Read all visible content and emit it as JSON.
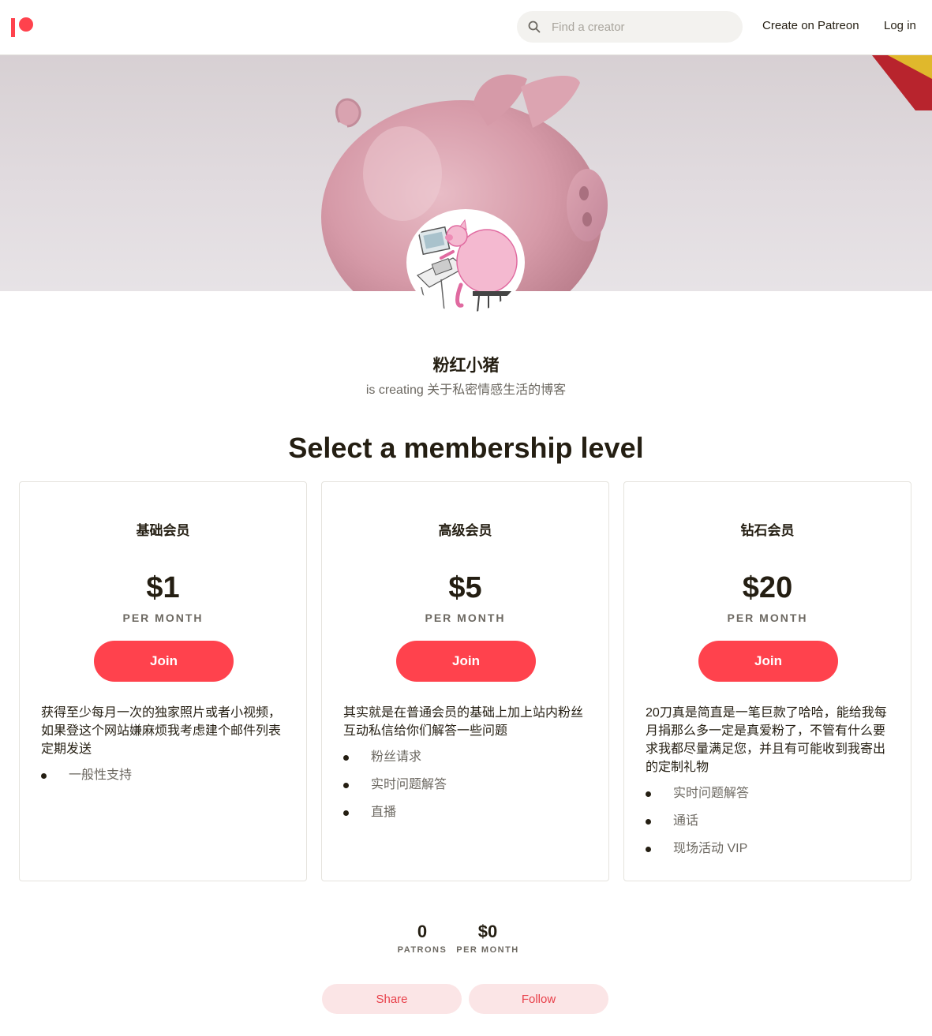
{
  "header": {
    "search_placeholder": "Find a creator",
    "create_label": "Create on Patreon",
    "login_label": "Log in"
  },
  "brand": {
    "accent": "#ff424d"
  },
  "profile": {
    "name": "粉红小猪",
    "tagline": "is creating 关于私密情感生活的博客"
  },
  "membership": {
    "title": "Select a membership level",
    "tiers": [
      {
        "name": "基础会员",
        "price": "$1",
        "period": "PER MONTH",
        "join_label": "Join",
        "description": "获得至少每月一次的独家照片或者小视频，如果登这个网站嫌麻烦我考虑建个邮件列表定期发送",
        "benefits": [
          "一般性支持"
        ]
      },
      {
        "name": "高级会员",
        "price": "$5",
        "period": "PER MONTH",
        "join_label": "Join",
        "description": "其实就是在普通会员的基础上加上站内粉丝互动私信给你们解答一些问题",
        "benefits": [
          "粉丝请求",
          "实时问题解答",
          "直播"
        ]
      },
      {
        "name": "钻石会员",
        "price": "$20",
        "period": "PER MONTH",
        "join_label": "Join",
        "description": "20刀真是简直是一笔巨款了哈哈，能给我每月捐那么多一定是真爱粉了，不管有什么要求我都尽量满足您，并且有可能收到我寄出的定制礼物",
        "benefits": [
          "实时问题解答",
          "通话",
          "现场活动 VIP"
        ]
      }
    ]
  },
  "stats": {
    "patrons_value": "0",
    "patrons_label": "PATRONS",
    "earnings_value": "$0",
    "earnings_label": "PER MONTH"
  },
  "actions": {
    "share_label": "Share",
    "follow_label": "Follow"
  }
}
